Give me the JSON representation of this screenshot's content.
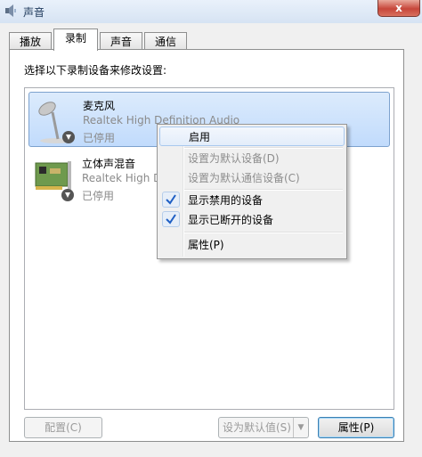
{
  "window": {
    "title": "声音",
    "close_label": "x"
  },
  "tabs": [
    "播放",
    "录制",
    "声音",
    "通信"
  ],
  "instruction": "选择以下录制设备来修改设置:",
  "devices": [
    {
      "name": "麦克风",
      "description": "Realtek High Definition Audio",
      "status": "已停用",
      "icon": "microphone-icon"
    },
    {
      "name": "立体声混音",
      "description": "Realtek High D",
      "status": "已停用",
      "icon": "sound-card-icon"
    }
  ],
  "context_menu": {
    "items": [
      {
        "label": "启用",
        "enabled": true,
        "checked": false
      },
      {
        "label": "设置为默认设备(D)",
        "enabled": false,
        "checked": false
      },
      {
        "label": "设置为默认通信设备(C)",
        "enabled": false,
        "checked": false
      },
      {
        "label": "显示禁用的设备",
        "enabled": true,
        "checked": true
      },
      {
        "label": "显示已断开的设备",
        "enabled": true,
        "checked": true
      },
      {
        "label": "属性(P)",
        "enabled": true,
        "checked": false
      }
    ]
  },
  "buttons": {
    "configure": "配置(C)",
    "set_default": "设为默认值(S)",
    "properties": "属性(P)"
  },
  "colors": {
    "selection": "#c1dbfc",
    "check": "#1f5fc4",
    "close": "#c7463a"
  }
}
